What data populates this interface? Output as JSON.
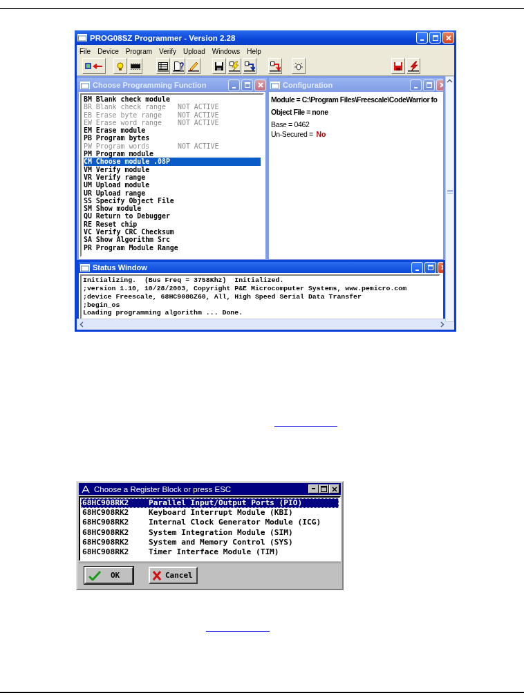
{
  "main_window": {
    "title": "PROG08SZ Programmer - Version 2.28",
    "menu": [
      "File",
      "Device",
      "Program",
      "Verify",
      "Upload",
      "Windows",
      "Help"
    ],
    "function_window": {
      "title": "Choose Programming Function",
      "active": false,
      "items": [
        {
          "text": "BM Blank check module",
          "disabled": false,
          "selected": false
        },
        {
          "text": "BR Blank check range",
          "note": "NOT ACTIVE",
          "disabled": true,
          "selected": false
        },
        {
          "text": "EB Erase byte range",
          "note": "NOT ACTIVE",
          "disabled": true,
          "selected": false
        },
        {
          "text": "EW Erase word range",
          "note": "NOT ACTIVE",
          "disabled": true,
          "selected": false
        },
        {
          "text": "EM Erase module",
          "disabled": false,
          "selected": false
        },
        {
          "text": "PB Program bytes",
          "disabled": false,
          "selected": false
        },
        {
          "text": "PW Program words",
          "note": "NOT ACTIVE",
          "disabled": true,
          "selected": false
        },
        {
          "text": "PM Program module",
          "disabled": false,
          "selected": false
        },
        {
          "text": "CM Choose module .08P",
          "disabled": false,
          "selected": true
        },
        {
          "text": "VM Verify module",
          "disabled": false,
          "selected": false
        },
        {
          "text": "VR Verify range",
          "disabled": false,
          "selected": false
        },
        {
          "text": "UM Upload module",
          "disabled": false,
          "selected": false
        },
        {
          "text": "UR Upload range",
          "disabled": false,
          "selected": false
        },
        {
          "text": "SS Specify Object File",
          "disabled": false,
          "selected": false
        },
        {
          "text": "SM Show module",
          "disabled": false,
          "selected": false
        },
        {
          "text": "QU Return to Debugger",
          "disabled": false,
          "selected": false
        },
        {
          "text": "RE Reset chip",
          "disabled": false,
          "selected": false
        },
        {
          "text": "VC Verify CRC Checksum",
          "disabled": false,
          "selected": false
        },
        {
          "text": "SA Show Algorithm Src",
          "disabled": false,
          "selected": false
        },
        {
          "text": "PR Program Module Range",
          "disabled": false,
          "selected": false
        }
      ]
    },
    "config_window": {
      "title": "Configuration",
      "active": false,
      "lines": [
        {
          "text": "Module = C:\\Program Files\\Freescale\\CodeWarrior fo",
          "bold": true
        },
        {
          "text": "Object File = none",
          "bold": true
        },
        {
          "text": "Base = 0462",
          "bold": false
        },
        {
          "text": "Un-Secured = ",
          "bold": false,
          "value": "No"
        }
      ]
    },
    "status_window": {
      "title": "Status Window",
      "active": true,
      "lines": [
        "Initializing.  (Bus Freq = 3758Khz)  Initialized.",
        ";version 1.10, 10/28/2003, Copyright P&E Microcomputer Systems, www.pemicro.com",
        ";device Freescale, 68HC908GZ60, All, High Speed Serial Data Transfer",
        ";begin_os",
        "Loading programming algorithm ... Done."
      ]
    }
  },
  "register_dialog": {
    "title": "Choose a Register Block or press ESC",
    "rows": [
      {
        "device": "68HC908RK2",
        "description": "Parallel Input/Output Ports (PIO)",
        "selected": true
      },
      {
        "device": "68HC908RK2",
        "description": "Keyboard Interrupt Module (KBI)",
        "selected": false
      },
      {
        "device": "68HC908RK2",
        "description": "Internal Clock Generator Module (ICG)",
        "selected": false
      },
      {
        "device": "68HC908RK2",
        "description": "System Integration Module (SIM)",
        "selected": false
      },
      {
        "device": "68HC908RK2",
        "description": "System and Memory Control (SYS)",
        "selected": false
      },
      {
        "device": "68HC908RK2",
        "description": "Timer Interface Module (TIM)",
        "selected": false
      }
    ],
    "buttons": [
      {
        "kind": "ok",
        "label": "OK"
      },
      {
        "kind": "cancel",
        "label": "Cancel"
      }
    ]
  }
}
